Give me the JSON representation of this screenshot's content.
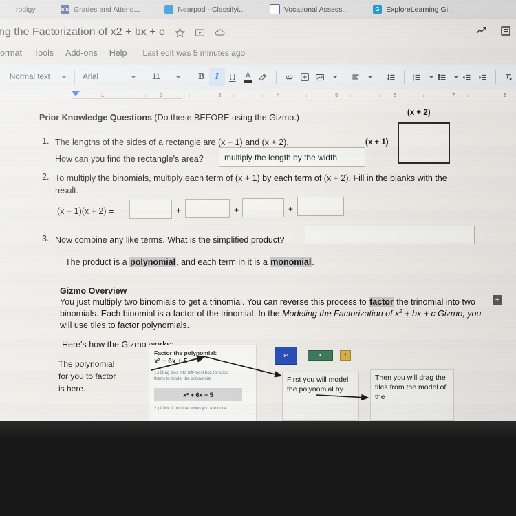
{
  "browser": {
    "tabs": [
      {
        "label": "rodigy",
        "icon": "prodigy-favicon",
        "badge": ""
      },
      {
        "label": "Grades and Attend...",
        "icon": "grades-favicon",
        "badge": "sis"
      },
      {
        "label": "Nearpod - Classifyi...",
        "icon": "nearpod-favicon",
        "badge": "N"
      },
      {
        "label": "Vocational Assess...",
        "icon": "vocational-favicon",
        "badge": "▤"
      },
      {
        "label": "ExploreLearning Gi...",
        "icon": "explorelearning-favicon",
        "badge": "G"
      }
    ]
  },
  "docs": {
    "title": "ng the Factorization of x2 + bx + c",
    "title_icons": [
      "star-icon",
      "move-to-folder-icon",
      "cloud-status-icon"
    ],
    "header_right_icons": [
      "activity-dashboard-icon",
      "hide-menus-icon"
    ],
    "menu": {
      "items": [
        "ormat",
        "Tools",
        "Add-ons",
        "Help"
      ],
      "last_edit": "Last edit was 5 minutes ago"
    },
    "toolbar": {
      "style_value": "Normal text",
      "font_value": "Arial",
      "size_value": "11",
      "bold_label": "B",
      "italic_label": "I",
      "underline_label": "U",
      "text_color_label": "A",
      "buttons": [
        "highlight-color-icon",
        "insert-link-icon",
        "add-comment-icon",
        "insert-image-icon",
        "align-icon",
        "line-spacing-icon",
        "numbered-list-icon",
        "bulleted-list-icon",
        "decrease-indent-icon",
        "increase-indent-icon",
        "clear-formatting-icon"
      ]
    },
    "ruler": {
      "marks": [
        "1",
        "2",
        "3",
        "4",
        "5",
        "6",
        "7",
        "8"
      ]
    }
  },
  "document": {
    "heading": "Prior Knowledge Questions",
    "heading_note": "(Do these BEFORE using the Gizmo.)",
    "q1": {
      "number": "1.",
      "line1": "The lengths of the sides of a rectangle are (x + 1) and (x + 2).",
      "line2": "How can you find the rectangle's area?",
      "answer": "multiply the length by the width"
    },
    "figure": {
      "top_label": "(x + 2)",
      "left_label": "(x + 1)"
    },
    "q2": {
      "number": "2.",
      "line1": "To multiply the binomials, multiply each term of (x + 1) by each term of (x + 2). Fill in the blanks with the",
      "line2": "result.",
      "expression": "(x + 1)(x + 2) =",
      "operators": [
        "+",
        "+",
        "+"
      ],
      "blanks": [
        "",
        "",
        "",
        ""
      ]
    },
    "q3": {
      "number": "3.",
      "prompt": "Now combine any like terms. What is the simplified product?",
      "answer": "",
      "note_pre": "The product is a ",
      "note_hl1": "polynomial",
      "note_mid": ", and each term in it is a ",
      "note_hl2": "monomial",
      "note_end": "."
    },
    "overview": {
      "heading": "Gizmo Overview",
      "line1_pre": "You just multiply two binomials to get a trinomial. You can reverse this process to ",
      "line1_hl": "factor",
      "line1_post": " the trinomial into two",
      "line2_pre": "binomials. Each binomial is a factor of the trinomial. In the ",
      "line2_em": "Modeling the Factorization",
      "line2_mid": " of x",
      "line2_sup": "2",
      "line2_post": " + bx + c Gizmo, you",
      "line3": "will use tiles to factor polynomials."
    },
    "howto": {
      "heading": "Here's how the Gizmo works:",
      "sidenote_line1": "The polynomial",
      "sidenote_line2": "for you to factor",
      "sidenote_line3": "is here.",
      "panel_title": "Factor the polynomial:",
      "panel_poly": "x² + 6x + 5",
      "step1": "1.) Drag tiles into left-most box (or click them) to model the polynomial",
      "field_value": "x² + 6x + 5",
      "step2": "2.) Click 'Continue' when you are done.",
      "tiles": [
        {
          "name": "x-squared-tile",
          "label": "x²",
          "color": "#2b4fb8"
        },
        {
          "name": "x-tile",
          "label": "x",
          "color": "#3e7d5c"
        },
        {
          "name": "unit-tile",
          "label": "1",
          "color": "#d9b44a"
        }
      ],
      "callout_left": "First you will model the polynomial by",
      "callout_right": "Then you will drag the tiles from the model of the"
    },
    "margin_button": "+"
  }
}
